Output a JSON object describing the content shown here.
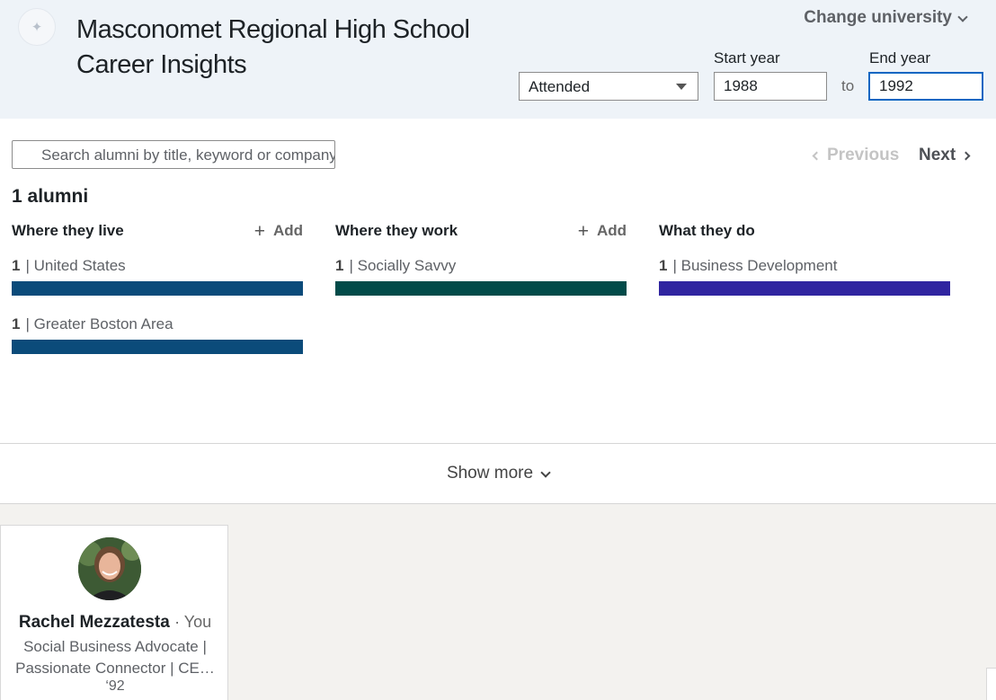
{
  "header": {
    "logo_text": "✦",
    "school_name": "Masconomet Regional High School",
    "subtitle": "Career Insights",
    "change_university": "Change university",
    "filter_select": "Attended",
    "start_year_label": "Start year",
    "start_year": "1988",
    "to_label": "to",
    "end_year_label": "End year",
    "end_year": "1992"
  },
  "search": {
    "placeholder": "Search alumni by title, keyword or company"
  },
  "pagination": {
    "previous": "Previous",
    "next": "Next"
  },
  "results": {
    "count_label": "1 alumni"
  },
  "columns": {
    "live": {
      "title": "Where they live",
      "add": "Add",
      "color": "#0b4b7a",
      "items": [
        {
          "count": "1",
          "label": "| United States"
        },
        {
          "count": "1",
          "label": "| Greater Boston Area"
        }
      ]
    },
    "work": {
      "title": "Where they work",
      "add": "Add",
      "color": "#024b49",
      "items": [
        {
          "count": "1",
          "label": "| Socially Savvy"
        }
      ]
    },
    "do": {
      "title": "What they do",
      "color": "#3025a0",
      "items": [
        {
          "count": "1",
          "label": "| Business Development"
        }
      ]
    }
  },
  "show_more": "Show more",
  "alumni_card": {
    "name": "Rachel Mezzatesta",
    "you_tag": "· You",
    "headline_line1": "Social Business Advocate |",
    "headline_line2": "Passionate Connector | CE…",
    "year": "‘92"
  }
}
